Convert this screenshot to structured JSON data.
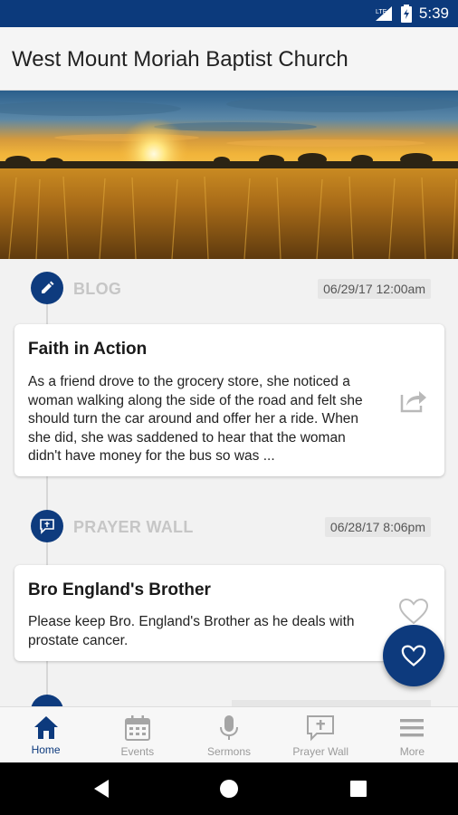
{
  "status_bar": {
    "time": "5:39",
    "network": "LTE"
  },
  "app_bar": {
    "title": "West Mount Moriah Baptist Church"
  },
  "feed": [
    {
      "section": "BLOG",
      "date": "06/29/17 12:00am",
      "title": "Faith in Action",
      "body": "As a friend drove to the grocery store, she noticed a woman walking along the side of the road and felt she should turn the car around and offer her a ride. When she did, she was saddened to hear that the woman didn't have money for the bus so was ..."
    },
    {
      "section": "PRAYER WALL",
      "date": "06/28/17 8:06pm",
      "title": "Bro England's Brother",
      "body": "Please keep Bro. England's Brother as he deals with prostate cancer."
    }
  ],
  "bottom_nav": [
    {
      "label": "Home",
      "icon": "home-icon",
      "active": true
    },
    {
      "label": "Events",
      "icon": "calendar-icon",
      "active": false
    },
    {
      "label": "Sermons",
      "icon": "microphone-icon",
      "active": false
    },
    {
      "label": "Prayer Wall",
      "icon": "prayer-wall-icon",
      "active": false
    },
    {
      "label": "More",
      "icon": "menu-icon",
      "active": false
    }
  ],
  "colors": {
    "primary": "#0d3a7d",
    "inactive": "#9a9a9a"
  }
}
